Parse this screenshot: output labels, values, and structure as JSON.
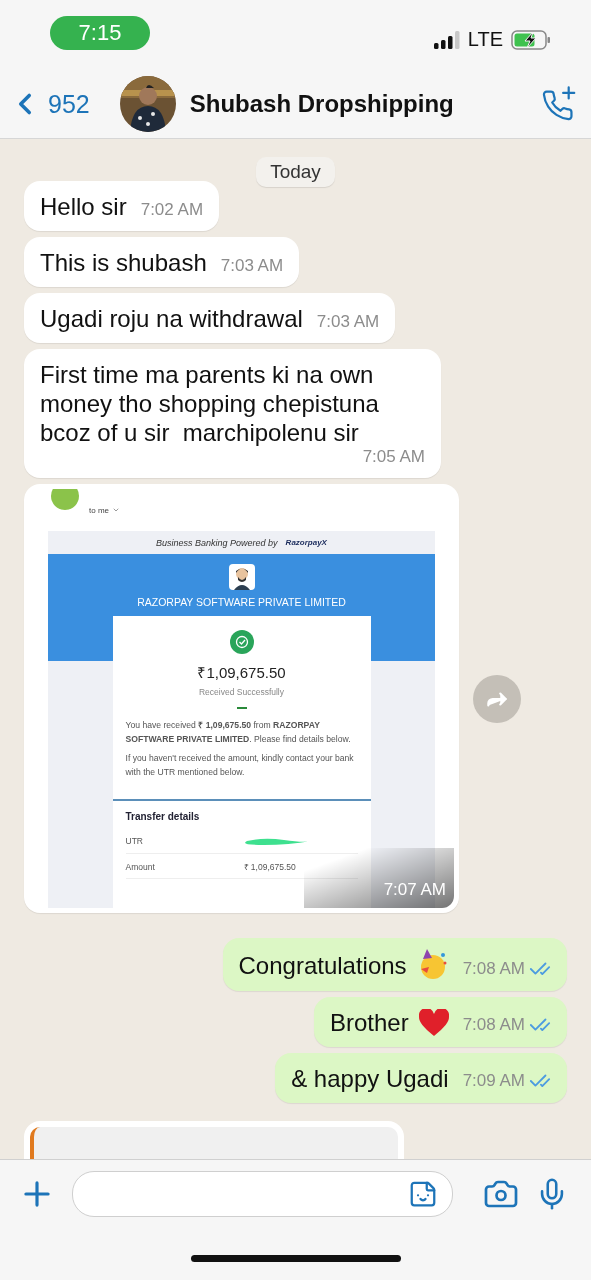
{
  "status_bar": {
    "time": "7:15",
    "network": "LTE"
  },
  "header": {
    "back_count": "952",
    "contact_name": "Shubash Dropshipping"
  },
  "date_badge": "Today",
  "messages": [
    {
      "kind": "text",
      "outgoing": false,
      "text": "Hello sir",
      "time": "7:02 AM"
    },
    {
      "kind": "text",
      "outgoing": false,
      "text": "This is shubash",
      "time": "7:03 AM"
    },
    {
      "kind": "text",
      "outgoing": false,
      "text": "Ugadi roju na withdrawal",
      "time": "7:03 AM"
    },
    {
      "kind": "text",
      "outgoing": false,
      "text": "First time ma parents ki na own money tho shopping chepistuna bcoz of u sir  marchipolenu sir",
      "time": "7:05 AM"
    },
    {
      "outgoing": false,
      "time": "7:07 AM",
      "email": {
        "recipient": "to me",
        "banner": "Business Banking Powered by",
        "banner_logo": "RazorpayX",
        "company": "RAZORPAY SOFTWARE PRIVATE LIMITED",
        "amount": "₹1,09,675.50",
        "status": "Received Successfully",
        "body": [
          "You have received **₹ 1,09,675.50** from **RAZORPAY SOFTWARE PRIVATE LIMITED**. Please find details below.",
          "If you haven't received the amount, kindly contact your bank with the UTR mentioned below."
        ],
        "details_title": "Transfer details",
        "details": [
          {
            "label": "UTR",
            "redacted": true
          },
          {
            "label": "Amount",
            "value": "₹ 1,09,675.50",
            "redacted": false
          }
        ]
      }
    },
    {
      "kind": "text",
      "outgoing": true,
      "text": "Congratulations",
      "sticker": {
        "kind": "party"
      },
      "time": "7:08 AM",
      "read": true
    },
    {
      "kind": "text",
      "outgoing": true,
      "text": "Brother",
      "sticker": {
        "kind": "heart"
      },
      "time": "7:08 AM",
      "read": true
    },
    {
      "kind": "text",
      "outgoing": true,
      "text": "& happy Ugadi",
      "time": "7:09 AM",
      "read": true
    }
  ]
}
